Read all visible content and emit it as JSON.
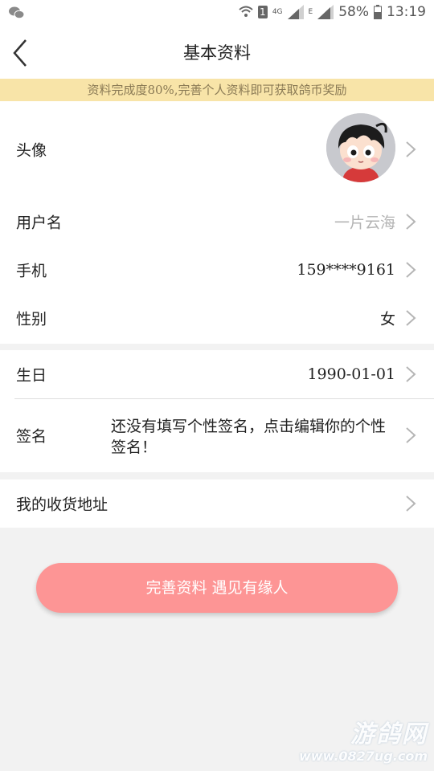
{
  "status_bar": {
    "network_4g": "4G",
    "network_e": "E",
    "sim_badge": "1",
    "battery_percent": "58%",
    "time": "13:19"
  },
  "header": {
    "title": "基本资料"
  },
  "banner": {
    "text": "资料完成度80%,完善个人资料即可获取鸽币奖励"
  },
  "profile": {
    "avatar_label": "头像",
    "username_label": "用户名",
    "username_value": "一片云海",
    "phone_label": "手机",
    "phone_value": "159****9161",
    "gender_label": "性别",
    "gender_value": "女",
    "birthday_label": "生日",
    "birthday_value": "1990-01-01",
    "signature_label": "签名",
    "signature_value": "还没有填写个性签名，点击编辑你的个性签名！",
    "address_label": "我的收货地址"
  },
  "button": {
    "label": "完善资料 遇见有缘人"
  },
  "watermark": {
    "brand": "游鸽网",
    "url": "www.0827ug.com"
  },
  "colors": {
    "banner_bg": "#f8e4a8",
    "button_bg": "#fd9595",
    "page_bg": "#f2f2f2"
  },
  "icons": [
    "wechat-icon",
    "wifi-icon",
    "signal-icon",
    "battery-icon",
    "back-arrow-icon",
    "chevron-right-icon"
  ]
}
